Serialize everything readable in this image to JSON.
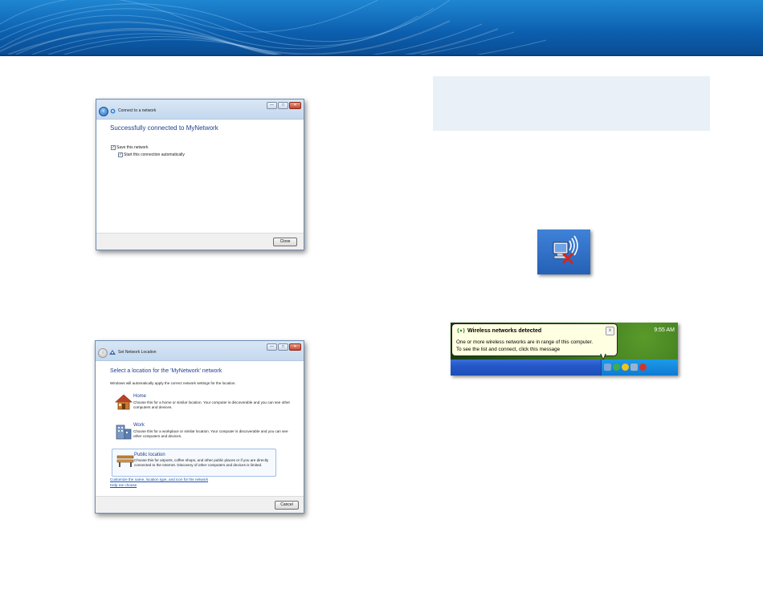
{
  "colors": {
    "banner": "#0c5fae",
    "note_box": "#e9f0f8",
    "dialog_heading": "#1e3f8f",
    "link": "#1a4fb0",
    "balloon": "#ffffe1",
    "xp_taskbar": "#2457c9"
  },
  "dialog_connect": {
    "title": "Connect to a network",
    "heading": "Successfully connected to MyNetwork",
    "checkbox_save": "Save this network",
    "checkbox_auto": "Start this connection automatically",
    "close_button": "Close",
    "window_buttons": {
      "minimize": "—",
      "maximize": "□",
      "close": "✕"
    }
  },
  "dialog_location": {
    "title": "Set Network Location",
    "heading": "Select a location for the 'MyNetwork' network",
    "subtext": "Windows will automatically apply the correct network settings for the location.",
    "options": [
      {
        "icon": "house-icon",
        "title": "Home",
        "desc": "Choose this for a home or similar location. Your computer is discoverable and you can see other computers and devices."
      },
      {
        "icon": "office-building-icon",
        "title": "Work",
        "desc": "Choose this for a workplace or similar location. Your computer is discoverable and you can see other computers and devices."
      },
      {
        "icon": "park-bench-icon",
        "title": "Public location",
        "desc": "Choose this for airports, coffee shops, and other public places or if you are directly connected to the Internet. Discovery of other computers and devices is limited."
      }
    ],
    "link_customize": "Customize the name, location type, and icon for the network",
    "link_help": "Help me choose",
    "cancel_button": "Cancel"
  },
  "xp_notification": {
    "balloon_title": "Wireless networks detected",
    "balloon_line1": "One or more wireless networks are in range of this computer.",
    "balloon_line2": "To see the list and connect, click this message",
    "close": "x",
    "clock": "9:55 AM"
  }
}
